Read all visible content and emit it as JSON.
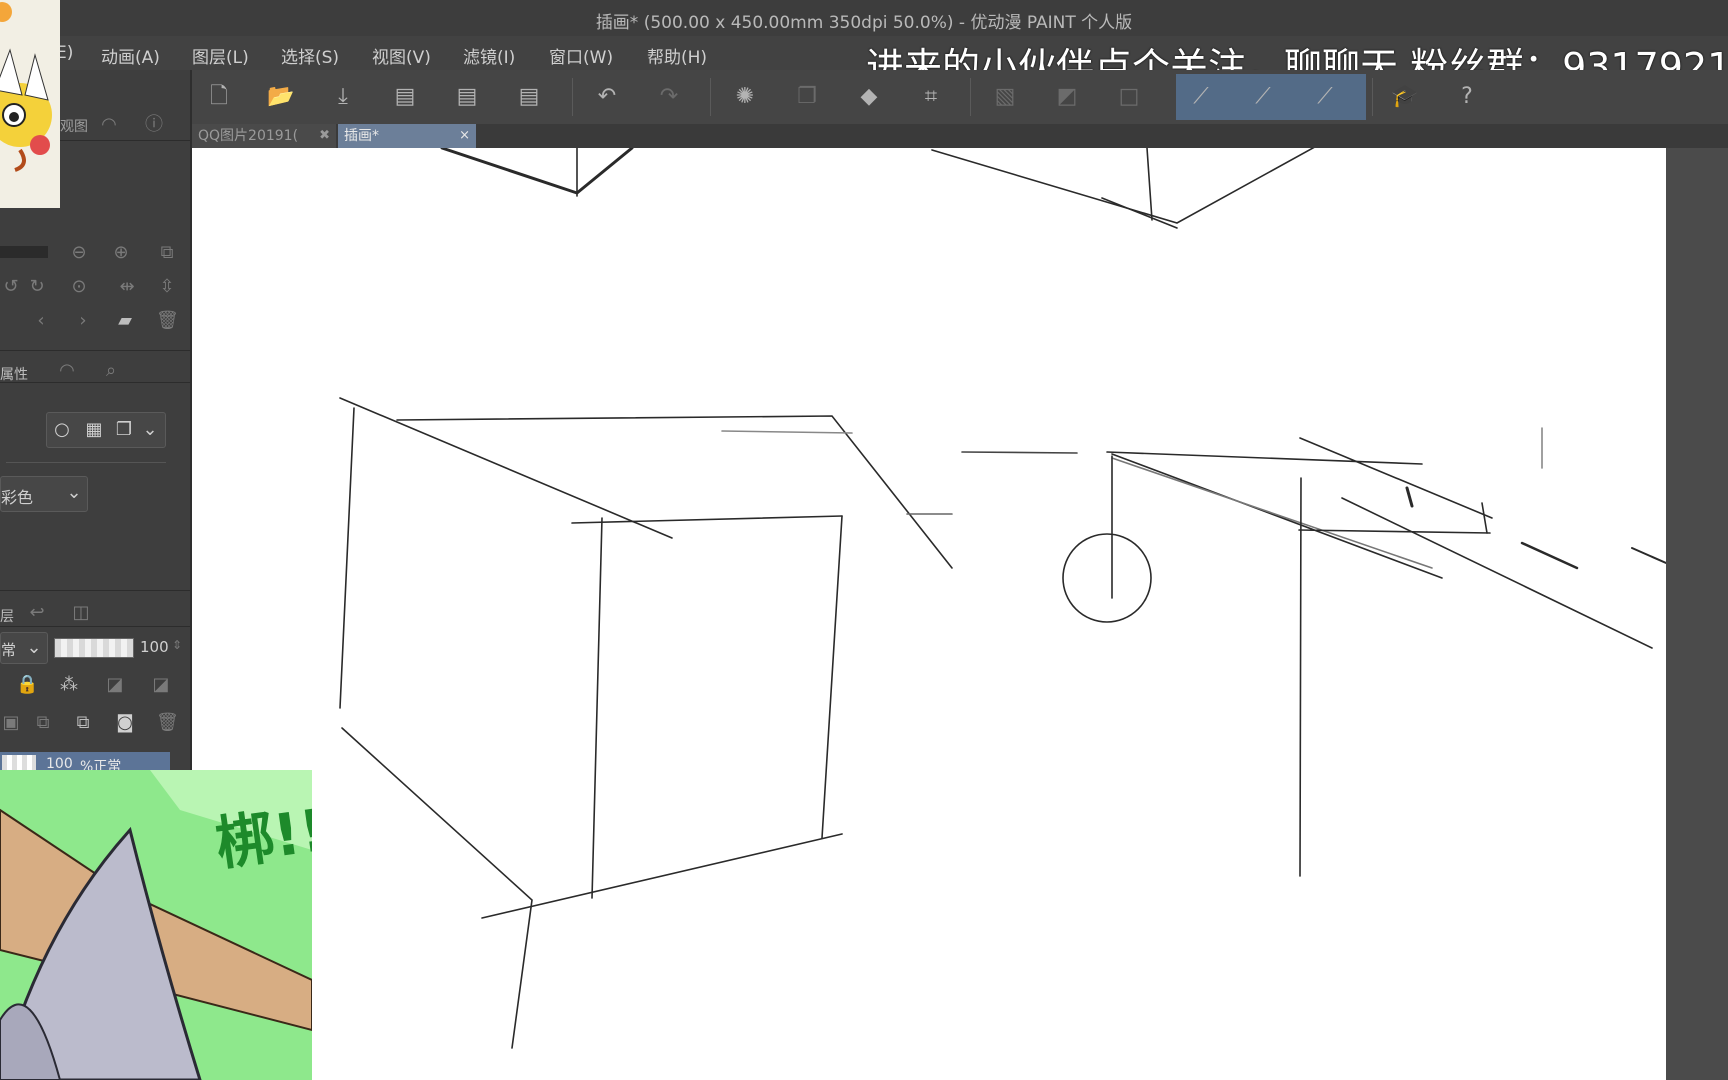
{
  "window": {
    "title": "插画* (500.00 x 450.00mm 350dpi 50.0%) - 优动漫 PAINT 个人版"
  },
  "menu": {
    "items": [
      {
        "label": "E)"
      },
      {
        "label": "动画(A)"
      },
      {
        "label": "图层(L)"
      },
      {
        "label": "选择(S)"
      },
      {
        "label": "视图(V)"
      },
      {
        "label": "滤镜(I)"
      },
      {
        "label": "窗口(W)"
      },
      {
        "label": "帮助(H)"
      }
    ]
  },
  "overlay": {
    "banner": "进来的小伙伴点个关注，聊聊天   粉丝群：9317921"
  },
  "tabs": [
    {
      "label": "QQ图片20191(",
      "close": "✖"
    },
    {
      "label": "插画*",
      "close": "×"
    }
  ],
  "left_panel": {
    "tab_a": "观图",
    "tool_property_tab": "属性",
    "color_mode_select": "彩色",
    "blend_mode_select": "常",
    "opacity_value": "100",
    "layer_row": {
      "opacity": "100",
      "mode": "%正常"
    },
    "layer_tab": "层"
  },
  "comic": {
    "text": "梆!!"
  },
  "colors": {
    "accent_active": "#536b87",
    "background": "#4a4a4a",
    "canvas": "#ffffff"
  },
  "toolbar_icons": [
    "new-file-icon",
    "open-file-icon",
    "save-icon",
    "export-jpg-icon",
    "export-png-icon",
    "export-psd-icon",
    "undo-icon",
    "redo-icon",
    "loading-spinner-icon",
    "copy-icon",
    "fill-icon",
    "transform-icon",
    "deselect-icon",
    "invert-icon",
    "crop-icon",
    "ruler-icon",
    "ruler-snap-icon",
    "perspective-ruler-icon",
    "learn-icon",
    "help-icon"
  ]
}
